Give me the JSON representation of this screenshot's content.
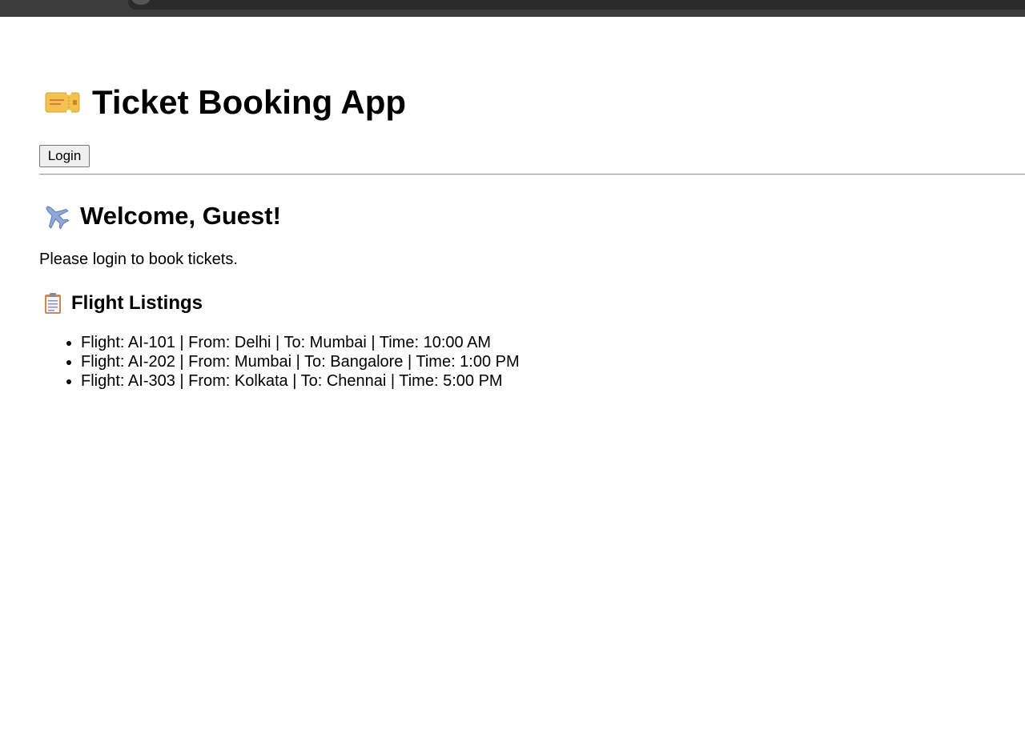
{
  "header": {
    "title": "Ticket Booking App",
    "icon": "ticket-icon"
  },
  "auth": {
    "login_label": "Login"
  },
  "welcome": {
    "heading": "Welcome, Guest!",
    "icon": "airplane-icon",
    "prompt": "Please login to book tickets."
  },
  "listings": {
    "heading": "Flight Listings",
    "icon": "clipboard-icon",
    "flights": [
      "Flight: AI-101 | From: Delhi | To: Mumbai | Time: 10:00 AM",
      "Flight: AI-202 | From: Mumbai | To: Bangalore | Time: 1:00 PM",
      "Flight: AI-303 | From: Kolkata | To: Chennai | Time: 5:00 PM"
    ]
  },
  "colors": {
    "background": "#ffffff",
    "text": "#000000",
    "browser_chrome": "#3c3c3c",
    "button_bg": "#efefef",
    "divider": "#9a9a9a"
  }
}
